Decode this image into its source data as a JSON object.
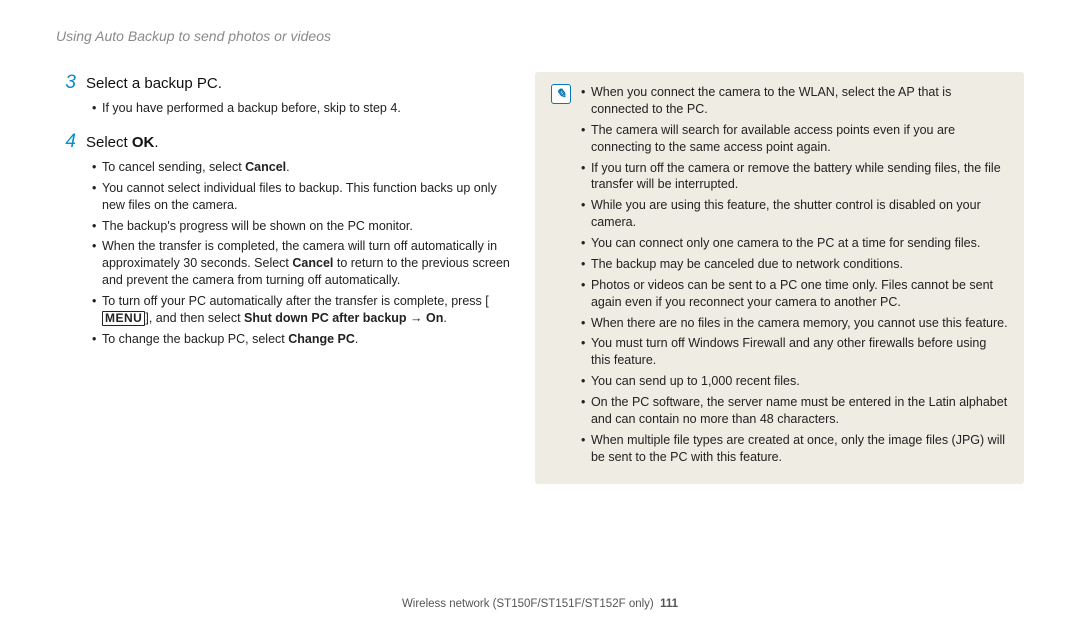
{
  "header": {
    "title": "Using Auto Backup to send photos or videos"
  },
  "steps": [
    {
      "num": "3",
      "title_html": "Select a backup PC.",
      "bullets_html": [
        "If you have performed a backup before, skip to step 4."
      ]
    },
    {
      "num": "4",
      "title_html": "Select <b>OK</b>.",
      "bullets_html": [
        "To cancel sending, select <b>Cancel</b>.",
        "You cannot select individual files to backup. This function backs up only new files on the camera.",
        "The backup's progress will be shown on the PC monitor.",
        "When the transfer is completed, the camera will turn off automatically in approximately 30 seconds. Select <b>Cancel</b> to return to the previous screen and prevent the camera from turning off automatically.",
        "To turn off your PC automatically after the transfer is complete, press [<span class=\"menu-glyph\">MENU</span>], and then select <b>Shut down PC after backup → On</b>.",
        "To change the backup PC, select <b>Change PC</b>."
      ]
    }
  ],
  "note_icon_label": "✎",
  "notes_html": [
    "When you connect the camera to the WLAN, select the AP that is connected to the PC.",
    "The camera will search for available access points even if you are connecting to the same access point again.",
    "If you turn off the camera or remove the battery while sending files, the file transfer will be interrupted.",
    "While you are using this feature, the shutter control is disabled on your camera.",
    "You can connect only one camera to the PC at a time for sending files.",
    "The backup may be canceled due to network conditions.",
    "Photos or videos can be sent to a PC one time only. Files cannot be sent again even if you reconnect your camera to another PC.",
    "When there are no files in the camera memory, you cannot use this feature.",
    "You must turn off Windows Firewall and any other firewalls before using this feature.",
    "You can send up to 1,000 recent files.",
    "On the PC software, the server name must be entered in the Latin alphabet and can contain no more than 48 characters.",
    "When multiple file types are created at once, only the image files (JPG) will be sent to the PC with this feature."
  ],
  "footer": {
    "section": "Wireless network  (ST150F/ST151F/ST152F only)",
    "page": "111"
  }
}
